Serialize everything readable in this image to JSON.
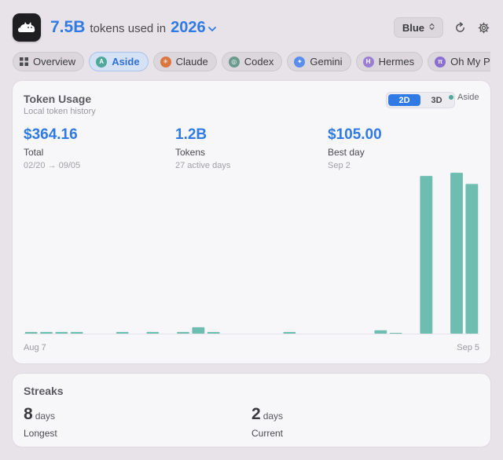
{
  "header": {
    "total": "7.5B",
    "used_text": "tokens used in",
    "year": "2026",
    "theme_label": "Blue"
  },
  "icons": {
    "app": "cat-cloud-icon",
    "year_dropdown": "chevron-down-icon",
    "theme_select": "up-down-chevron-icon",
    "refresh": "refresh-icon",
    "settings": "gear-icon"
  },
  "tabs": [
    {
      "label": "Overview",
      "icon": "grid-icon",
      "color": "#4a4a50",
      "glyph": "",
      "active": false
    },
    {
      "label": "Aside",
      "icon": "aside-icon",
      "color": "#4fa89a",
      "glyph": "A",
      "active": true
    },
    {
      "label": "Claude",
      "icon": "claude-icon",
      "color": "#d9773f",
      "glyph": "✳",
      "active": false
    },
    {
      "label": "Codex",
      "icon": "codex-icon",
      "color": "#6a9a8c",
      "glyph": "◎",
      "active": false
    },
    {
      "label": "Gemini",
      "icon": "gemini-icon",
      "color": "#5b8def",
      "glyph": "✦",
      "active": false
    },
    {
      "label": "Hermes",
      "icon": "hermes-icon",
      "color": "#9b7fd6",
      "glyph": "H",
      "active": false
    },
    {
      "label": "Oh My P",
      "icon": "pi-icon",
      "color": "#8b6fd0",
      "glyph": "π",
      "active": false
    }
  ],
  "usage": {
    "title": "Token Usage",
    "subtitle": "Local token history",
    "toggle": [
      "2D",
      "3D"
    ],
    "toggle_active": "2D",
    "legend_label": "Aside",
    "stats": [
      {
        "value": "$364.16",
        "label": "Total",
        "sub": "02/20 → 09/05"
      },
      {
        "value": "1.2B",
        "label": "Tokens",
        "sub": "27 active days"
      },
      {
        "value": "$105.00",
        "label": "Best day",
        "sub": "Sep 2"
      }
    ]
  },
  "chart_data": {
    "type": "bar",
    "x_start": "Aug 7",
    "x_end": "Sep 5",
    "series_color": "#6dbdb0",
    "values": [
      0.6,
      0.6,
      0.6,
      0.6,
      0,
      0,
      0.6,
      0,
      0.6,
      0,
      0.6,
      2.3,
      0.6,
      0,
      0,
      0,
      0,
      0.6,
      0,
      0,
      0,
      0,
      0,
      1.2,
      0.3,
      0,
      56.6,
      0,
      57.7,
      53.7
    ],
    "ylim": [
      0,
      60
    ]
  },
  "streaks": {
    "title": "Streaks",
    "items": [
      {
        "value": "8",
        "unit": "days",
        "label": "Longest"
      },
      {
        "value": "2",
        "unit": "days",
        "label": "Current"
      }
    ]
  }
}
